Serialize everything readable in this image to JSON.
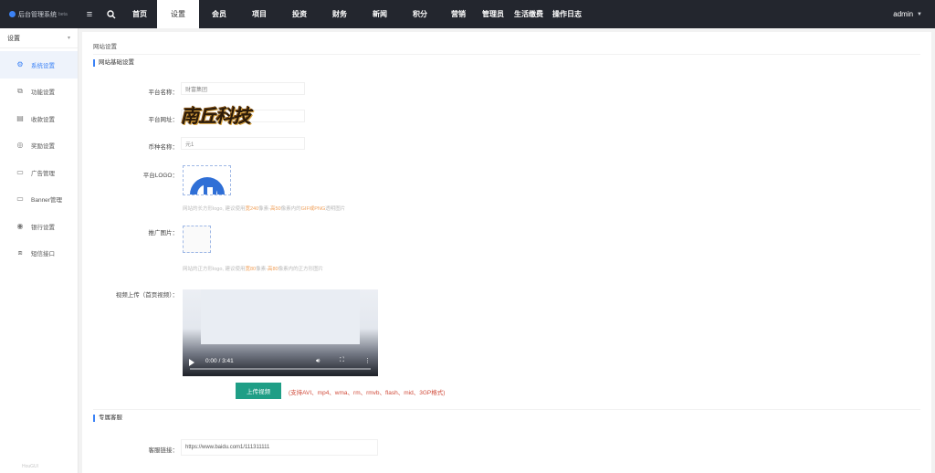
{
  "app": {
    "title": "后台管理系统",
    "version": "beta"
  },
  "nav": {
    "items": [
      {
        "label": "首页"
      },
      {
        "label": "设置",
        "active": true
      },
      {
        "label": "会员"
      },
      {
        "label": "项目"
      },
      {
        "label": "投资"
      },
      {
        "label": "财务"
      },
      {
        "label": "新闻"
      },
      {
        "label": "积分"
      },
      {
        "label": "营销"
      },
      {
        "label": "管理员"
      },
      {
        "label": "生活缴费"
      },
      {
        "label": "操作日志"
      }
    ],
    "user": "admin"
  },
  "sidebar": {
    "title": "设置",
    "items": [
      {
        "label": "系统设置",
        "icon": "gear-icon",
        "active": true
      },
      {
        "label": "功能设置",
        "icon": "puzzle-icon"
      },
      {
        "label": "收款设置",
        "icon": "receipt-icon"
      },
      {
        "label": "奖励设置",
        "icon": "target-icon"
      },
      {
        "label": "广告管理",
        "icon": "message-icon"
      },
      {
        "label": "Banner管理",
        "icon": "chat-icon"
      },
      {
        "label": "银行设置",
        "icon": "bank-icon"
      },
      {
        "label": "短信接口",
        "icon": "sms-icon"
      }
    ],
    "footer": "HouGUI"
  },
  "main": {
    "breadcrumb": "网站设置",
    "section_basic": "网站基础设置",
    "fields": {
      "platform_name": {
        "label": "平台名称：",
        "value": "财富集团"
      },
      "platform_url": {
        "label": "平台网址：",
        "value": ""
      },
      "currency_name": {
        "label": "币种名称：",
        "value": "元1"
      },
      "platform_logo": {
        "label": "平台LOGO："
      },
      "promo_image": {
        "label": "推广图片："
      },
      "video_upload": {
        "label": "视频上传（首页视频）："
      }
    },
    "logo_hint": {
      "text1": "网站的长方形logo, 建议使用",
      "w": "宽240",
      "mid": "像素-",
      "h": "高50",
      "mid2": "像素内的",
      "gif": "GIF或PNG",
      "tail": "透明图片"
    },
    "promo_hint": {
      "text1": "网站的正方形logo, 建议使用",
      "w": "宽80",
      "mid": "像素-",
      "h": "高80",
      "tail": "像素内的正方形图片"
    },
    "watermark": "南丘科技",
    "video": {
      "time": "0:00 / 3:41"
    },
    "upload_button": "上传视频",
    "upload_note": "(支持AVI、mp4、wma、rm、rmvb、flash、mid、3GP格式)",
    "section_service": "专属客服",
    "service_link": {
      "label": "客服链接：",
      "value": "https://www.baidu.com1/111311111"
    }
  }
}
